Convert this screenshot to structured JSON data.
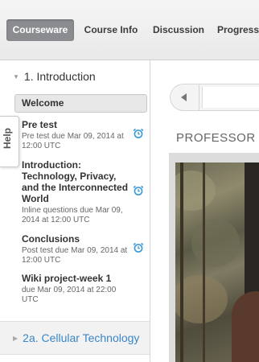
{
  "nav": {
    "tabs": [
      {
        "label": "Courseware",
        "active": true
      },
      {
        "label": "Course Info",
        "active": false
      },
      {
        "label": "Discussion",
        "active": false
      },
      {
        "label": "Progress",
        "active": false
      }
    ]
  },
  "sidebar": {
    "chapter1": {
      "title": "1. Introduction",
      "icon": "chevron-down-icon"
    },
    "welcome": "Welcome",
    "items": [
      {
        "title": "Pre test",
        "sub": "Pre test due Mar 09, 2014 at 12:00 UTC",
        "alarm": true
      },
      {
        "title": "Introduction: Technology, Privacy, and the Interconnected World",
        "sub": "Inline questions due Mar 09, 2014 at 12:00 UTC",
        "alarm": true
      },
      {
        "title": "Conclusions",
        "sub": "Post test due Mar 09, 2014 at 12:00 UTC",
        "alarm": true
      },
      {
        "title": "Wiki project-week 1",
        "sub": "due Mar 09, 2014 at 22:00 UTC",
        "alarm": false
      }
    ],
    "chapter2": {
      "title": "2a. Cellular Technology",
      "icon": "chevron-right-icon"
    }
  },
  "help": {
    "label": "Help"
  },
  "main": {
    "unit_title": "PROFESSOR S"
  },
  "colors": {
    "active_tab_bg": "#8a8c8f",
    "link_blue": "#3a86c7",
    "alarm_blue": "#3a9ad9"
  }
}
